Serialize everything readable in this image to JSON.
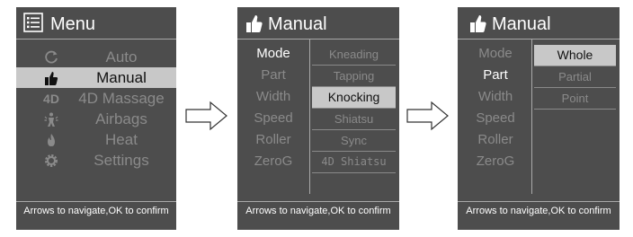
{
  "menu_screen": {
    "title": "Menu",
    "items": [
      {
        "label": "Auto",
        "icon": "refresh-icon"
      },
      {
        "label": "Manual",
        "icon": "thumbs-up-icon"
      },
      {
        "label": "4D Massage",
        "icon": "4d-icon",
        "icon_text": "4D"
      },
      {
        "label": "Airbags",
        "icon": "airbags-icon"
      },
      {
        "label": "Heat",
        "icon": "flame-icon"
      },
      {
        "label": "Settings",
        "icon": "gear-icon"
      }
    ],
    "selected_index": 1,
    "footer": "Arrows to navigate,OK to confirm"
  },
  "manual_mode_screen": {
    "title": "Manual",
    "left_items": [
      "Mode",
      "Part",
      "Width",
      "Speed",
      "Roller",
      "ZeroG"
    ],
    "active_left": "Mode",
    "right_items": [
      "Kneading",
      "Tapping",
      "Knocking",
      "Shiatsu",
      "Sync",
      "4D Shiatsu"
    ],
    "selected_right": "Knocking",
    "footer": "Arrows to navigate,OK to confirm"
  },
  "manual_part_screen": {
    "title": "Manual",
    "left_items": [
      "Mode",
      "Part",
      "Width",
      "Speed",
      "Roller",
      "ZeroG"
    ],
    "active_left": "Part",
    "right_items": [
      "Whole",
      "Partial",
      "Point"
    ],
    "selected_right": "Whole",
    "footer": "Arrows to navigate,OK to confirm"
  },
  "colors": {
    "screen_bg": "#4d4d4d",
    "selection_bg": "#c8c8c8",
    "inactive_text": "#8a8a8a",
    "active_text": "#ffffff"
  }
}
